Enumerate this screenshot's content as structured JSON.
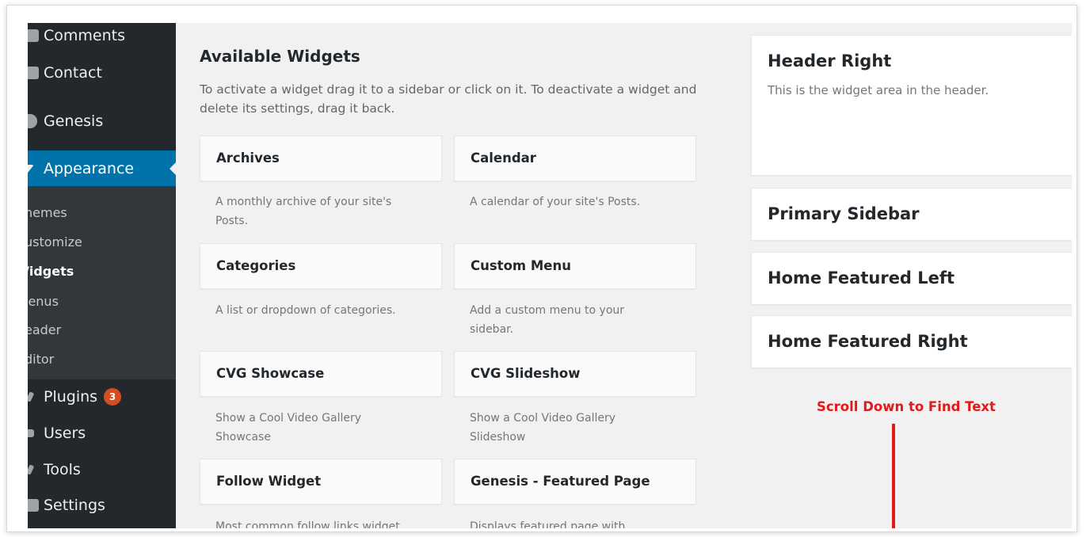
{
  "sidebar": {
    "items": [
      {
        "label": "Comments",
        "icon": "comment-icon"
      },
      {
        "label": "Contact",
        "icon": "contact-form-icon"
      },
      {
        "label": "Genesis",
        "icon": "genesis-icon"
      },
      {
        "label": "Appearance",
        "icon": "paintbrush-icon"
      },
      {
        "label": "Plugins",
        "icon": "plugin-icon",
        "badge": "3"
      },
      {
        "label": "Users",
        "icon": "users-icon"
      },
      {
        "label": "Tools",
        "icon": "tools-icon"
      },
      {
        "label": "Settings",
        "icon": "settings-icon"
      }
    ],
    "submenu": [
      "hemes",
      "ustomize",
      "/idgets",
      "lenus",
      "eader",
      "ditor"
    ]
  },
  "available": {
    "title": "Available Widgets",
    "description": "To activate a widget drag it to a sidebar or click on it. To deactivate a widget and delete its settings, drag it back.",
    "widgets": [
      {
        "title": "Archives",
        "desc": "A monthly archive of your site's Posts."
      },
      {
        "title": "Calendar",
        "desc": "A calendar of your site's Posts."
      },
      {
        "title": "Categories",
        "desc": "A list or dropdown of categories."
      },
      {
        "title": "Custom Menu",
        "desc": "Add a custom menu to your sidebar."
      },
      {
        "title": "CVG Showcase",
        "desc": "Show a Cool Video Gallery Showcase"
      },
      {
        "title": "CVG Slideshow",
        "desc": "Show a Cool Video Gallery Slideshow"
      },
      {
        "title": "Follow Widget",
        "desc": "Most common follow links widget"
      },
      {
        "title": "Genesis - Featured Page",
        "desc": "Displays featured page with"
      }
    ]
  },
  "areas": [
    {
      "title": "Header Right",
      "desc": "This is the widget area in the header."
    },
    {
      "title": "Primary Sidebar"
    },
    {
      "title": "Home Featured Left"
    },
    {
      "title": "Home Featured Right"
    }
  ],
  "annotation": {
    "text": "Scroll Down to Find Text",
    "color": "#e01b1b"
  },
  "colors": {
    "sidebar_bg": "#23282d",
    "active_bg": "#0073aa",
    "badge_bg": "#d54e21"
  }
}
